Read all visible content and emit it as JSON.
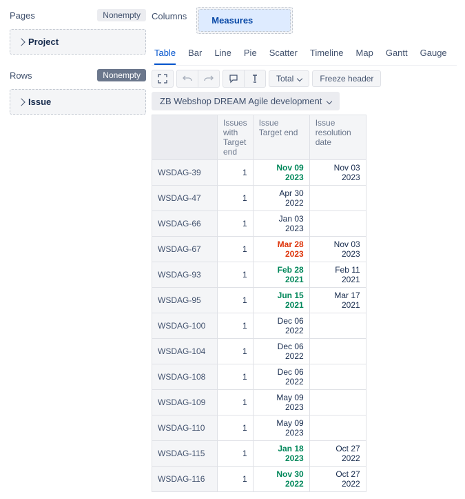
{
  "sidebar": {
    "pages": {
      "title": "Pages",
      "badge": "Nonempty",
      "items": [
        {
          "label": "Project"
        }
      ]
    },
    "rows": {
      "title": "Rows",
      "badge": "Nonempty",
      "items": [
        {
          "label": "Issue"
        }
      ]
    }
  },
  "columns": {
    "title": "Columns",
    "pill": "Measures"
  },
  "tabs": [
    "Table",
    "Bar",
    "Line",
    "Pie",
    "Scatter",
    "Timeline",
    "Map",
    "Gantt",
    "Gauge"
  ],
  "toolbar": {
    "total": "Total",
    "freeze": "Freeze header"
  },
  "context": "ZB Webshop DREAM Agile development",
  "table": {
    "headers": [
      "Issues with Target end",
      "Issue Target end",
      "Issue resolution date"
    ],
    "rows": [
      {
        "id": "WSDAG-39",
        "n": 1,
        "target": "Nov 09 2023",
        "tc": "green",
        "res": "Nov 03 2023"
      },
      {
        "id": "WSDAG-47",
        "n": 1,
        "target": "Apr 30 2022",
        "tc": "",
        "res": ""
      },
      {
        "id": "WSDAG-66",
        "n": 1,
        "target": "Jan 03 2023",
        "tc": "",
        "res": ""
      },
      {
        "id": "WSDAG-67",
        "n": 1,
        "target": "Mar 28 2023",
        "tc": "red",
        "res": "Nov 03 2023"
      },
      {
        "id": "WSDAG-93",
        "n": 1,
        "target": "Feb 28 2021",
        "tc": "green",
        "res": "Feb 11 2021"
      },
      {
        "id": "WSDAG-95",
        "n": 1,
        "target": "Jun 15 2021",
        "tc": "green",
        "res": "Mar 17 2021"
      },
      {
        "id": "WSDAG-100",
        "n": 1,
        "target": "Dec 06 2022",
        "tc": "",
        "res": ""
      },
      {
        "id": "WSDAG-104",
        "n": 1,
        "target": "Dec 06 2022",
        "tc": "",
        "res": ""
      },
      {
        "id": "WSDAG-108",
        "n": 1,
        "target": "Dec 06 2022",
        "tc": "",
        "res": ""
      },
      {
        "id": "WSDAG-109",
        "n": 1,
        "target": "May 09 2023",
        "tc": "",
        "res": ""
      },
      {
        "id": "WSDAG-110",
        "n": 1,
        "target": "May 09 2023",
        "tc": "",
        "res": ""
      },
      {
        "id": "WSDAG-115",
        "n": 1,
        "target": "Jan 18 2023",
        "tc": "green",
        "res": "Oct 27 2022"
      },
      {
        "id": "WSDAG-116",
        "n": 1,
        "target": "Nov 30 2022",
        "tc": "green",
        "res": "Oct 27 2022"
      }
    ]
  }
}
